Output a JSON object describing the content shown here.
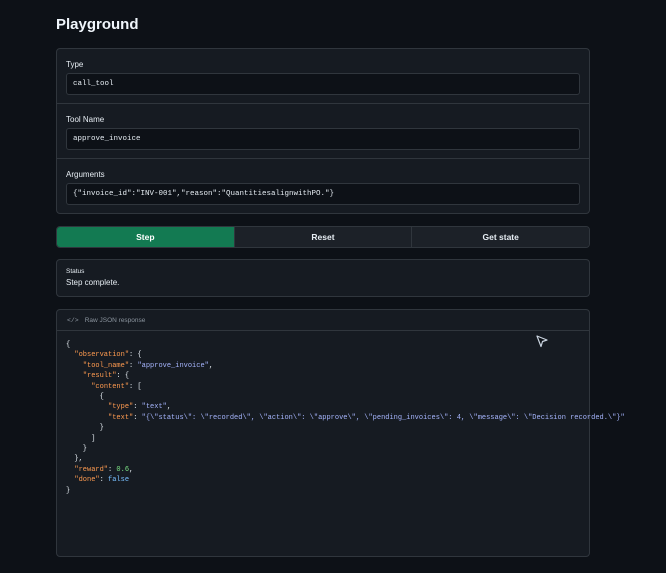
{
  "page": {
    "title": "Playground"
  },
  "fields": [
    {
      "label": "Type",
      "value": "call_tool"
    },
    {
      "label": "Tool Name",
      "value": "approve_invoice"
    },
    {
      "label": "Arguments",
      "value": "{\"invoice_id\":\"INV-001\",\"reason\":\"QuantitiesalignwithPO.\"}"
    }
  ],
  "buttons": {
    "step": "Step",
    "reset": "Reset",
    "get_state": "Get state"
  },
  "status": {
    "label": "Status",
    "text": "Step complete."
  },
  "raw": {
    "icon": "code-icon",
    "header": "Raw JSON response",
    "json": {
      "open_brace": "{",
      "observation_key": "\"observation\"",
      "tool_name_key": "\"tool_name\"",
      "tool_name_value": "\"approve_invoice\"",
      "result_key": "\"result\"",
      "content_key": "\"content\"",
      "type_key": "\"type\"",
      "type_value": "\"text\"",
      "text_key": "\"text\"",
      "text_value": "\"{\\\"status\\\": \\\"recorded\\\", \\\"action\\\": \\\"approve\\\", \\\"pending_invoices\\\": 4, \\\"message\\\": \\\"Decision recorded.\\\"}\"",
      "reward_key": "\"reward\"",
      "reward_value": "0.6",
      "done_key": "\"done\"",
      "done_value": "false"
    }
  },
  "colors": {
    "background": "#0d1117",
    "panel": "#161b22",
    "border": "#30363d",
    "primary_button": "#137a52",
    "json_key": "#ff9b50",
    "json_string": "#a5b4fc",
    "json_number": "#7ee787",
    "json_boolean": "#79c0ff"
  }
}
